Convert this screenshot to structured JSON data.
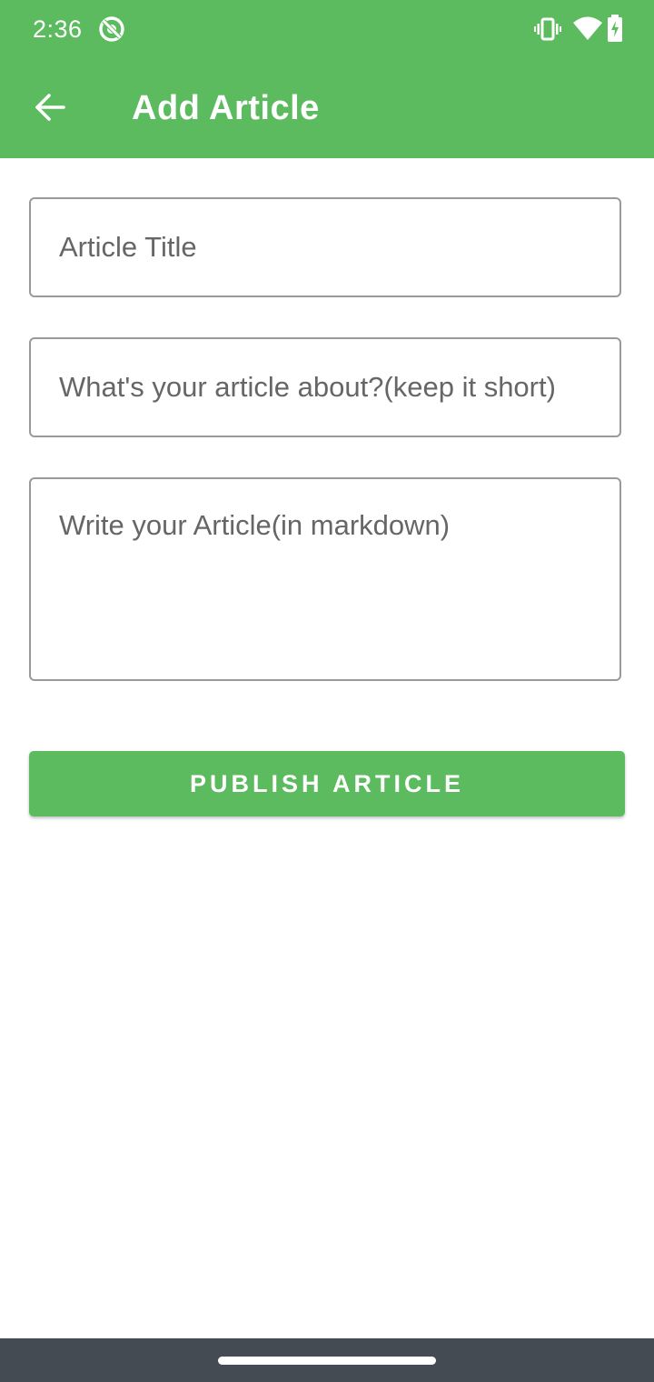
{
  "status_bar": {
    "time": "2:36",
    "icons": [
      "sync-disabled-icon",
      "vibrate-icon",
      "wifi-icon",
      "battery-charging-icon"
    ]
  },
  "app_bar": {
    "back_icon": "arrow-back-icon",
    "title": "Add Article"
  },
  "form": {
    "title_field": {
      "placeholder": "Article Title",
      "value": ""
    },
    "description_field": {
      "placeholder": "What's your article about?(keep it short)",
      "value": ""
    },
    "body_field": {
      "placeholder": "Write your Article(in markdown)",
      "value": ""
    },
    "publish_label": "PUBLISH ARTICLE"
  },
  "colors": {
    "primary": "#5cbb5e",
    "nav_bar": "#454b52",
    "field_border": "#9a9a9a",
    "placeholder": "#666666"
  }
}
